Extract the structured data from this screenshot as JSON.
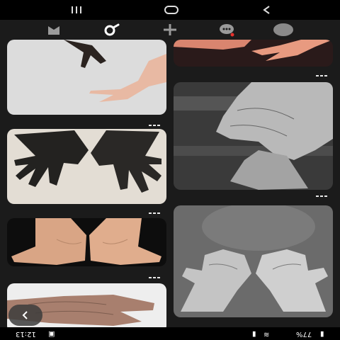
{
  "system_nav": {
    "buttons": [
      "recents",
      "home",
      "back"
    ]
  },
  "toolbar": {
    "icons": [
      "bookmark-icon",
      "search-icon",
      "add-icon",
      "chat-icon",
      "profile-icon"
    ],
    "active": "search-icon",
    "accent": "#e6312d"
  },
  "status_bar": {
    "time": "12:13",
    "battery": "77%"
  },
  "images": [
    {
      "desc": "dark hand reaching toward pale hand"
    },
    {
      "desc": "two dark hands clawing"
    },
    {
      "desc": "open palms holding"
    },
    {
      "desc": "elderly hand on white cloth"
    },
    {
      "desc": "two hands reaching"
    },
    {
      "desc": "elderly hands clasped in black and white"
    },
    {
      "desc": "wrinkled open palms in black and white"
    }
  ]
}
